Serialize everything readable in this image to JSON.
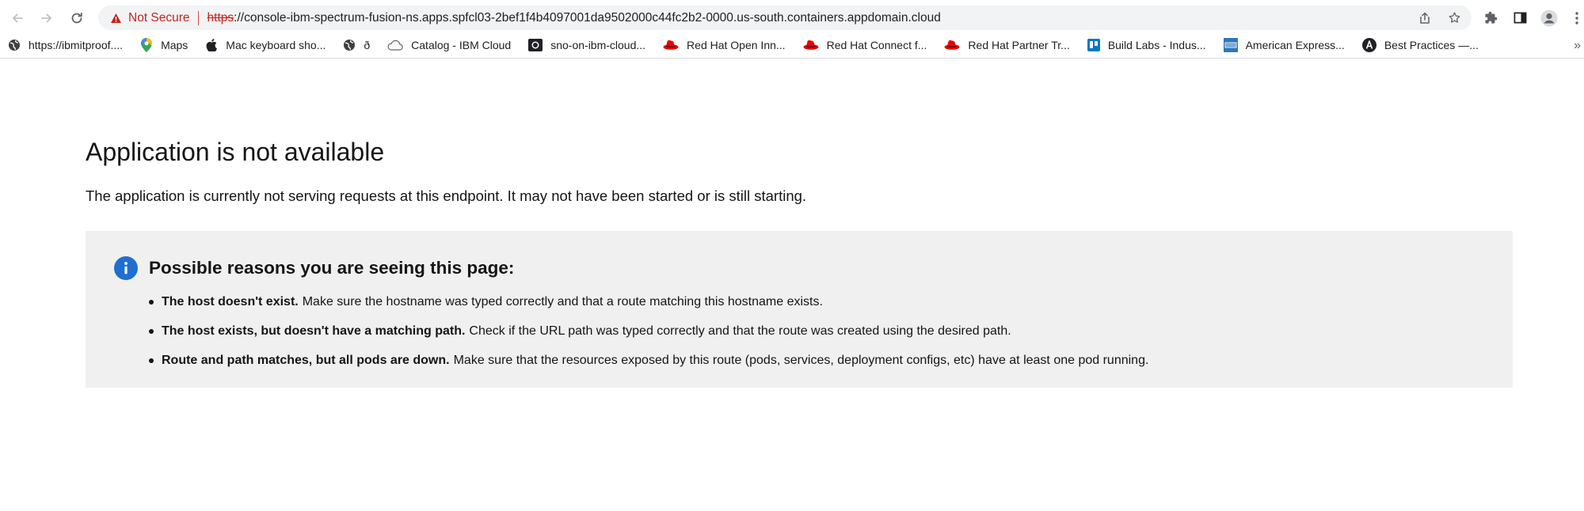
{
  "browser": {
    "nav": {
      "back_icon": "arrow-left-icon",
      "forward_icon": "arrow-right-icon",
      "reload_icon": "reload-icon"
    },
    "omnibox": {
      "security_label": "Not Secure",
      "scheme": "https",
      "url_rest": "://console-ibm-spectrum-fusion-ns.apps.spfcl03-2bef1f4b4097001da9502000c44fc2b2-0000.us-south.containers.appdomain.cloud",
      "colors": {
        "warning": "#c5221f",
        "background": "#f1f3f4"
      }
    },
    "toolbar_icons": [
      "share-icon",
      "star-icon",
      "extensions-icon",
      "side-panel-icon",
      "profile-icon",
      "menu-icon"
    ],
    "bookmarks": [
      {
        "label": "https://ibmitproof....",
        "icon": "globe-icon"
      },
      {
        "label": "Maps",
        "icon": "maps-icon"
      },
      {
        "label": "Mac keyboard sho...",
        "icon": "apple-icon"
      },
      {
        "label": "ð",
        "icon": "globe-icon"
      },
      {
        "label": "Catalog - IBM Cloud",
        "icon": "cloud-icon"
      },
      {
        "label": "sno-on-ibm-cloud...",
        "icon": "github-icon"
      },
      {
        "label": "Red Hat Open Inn...",
        "icon": "redhat-icon"
      },
      {
        "label": "Red Hat Connect f...",
        "icon": "redhat-icon"
      },
      {
        "label": "Red Hat Partner Tr...",
        "icon": "redhat-icon"
      },
      {
        "label": "Build Labs - Indus...",
        "icon": "trello-icon"
      },
      {
        "label": "American Express...",
        "icon": "amex-icon"
      },
      {
        "label": "Best Practices —...",
        "icon": "angular-icon"
      }
    ],
    "bookmarks_overflow": "»"
  },
  "page": {
    "title": "Application is not available",
    "description": "The application is currently not serving requests at this endpoint. It may not have been started or is still starting.",
    "panel": {
      "icon": "info-icon",
      "title": "Possible reasons you are seeing this page:",
      "reasons": [
        {
          "bold": "The host doesn't exist.",
          "text": "Make sure the hostname was typed correctly and that a route matching this hostname exists."
        },
        {
          "bold": "The host exists, but doesn't have a matching path.",
          "text": "Check if the URL path was typed correctly and that the route was created using the desired path."
        },
        {
          "bold": "Route and path matches, but all pods are down.",
          "text": "Make sure that the resources exposed by this route (pods, services, deployment configs, etc) have at least one pod running."
        }
      ],
      "colors": {
        "background": "#f0f0f0",
        "info_blue": "#1f6fd0"
      }
    }
  }
}
